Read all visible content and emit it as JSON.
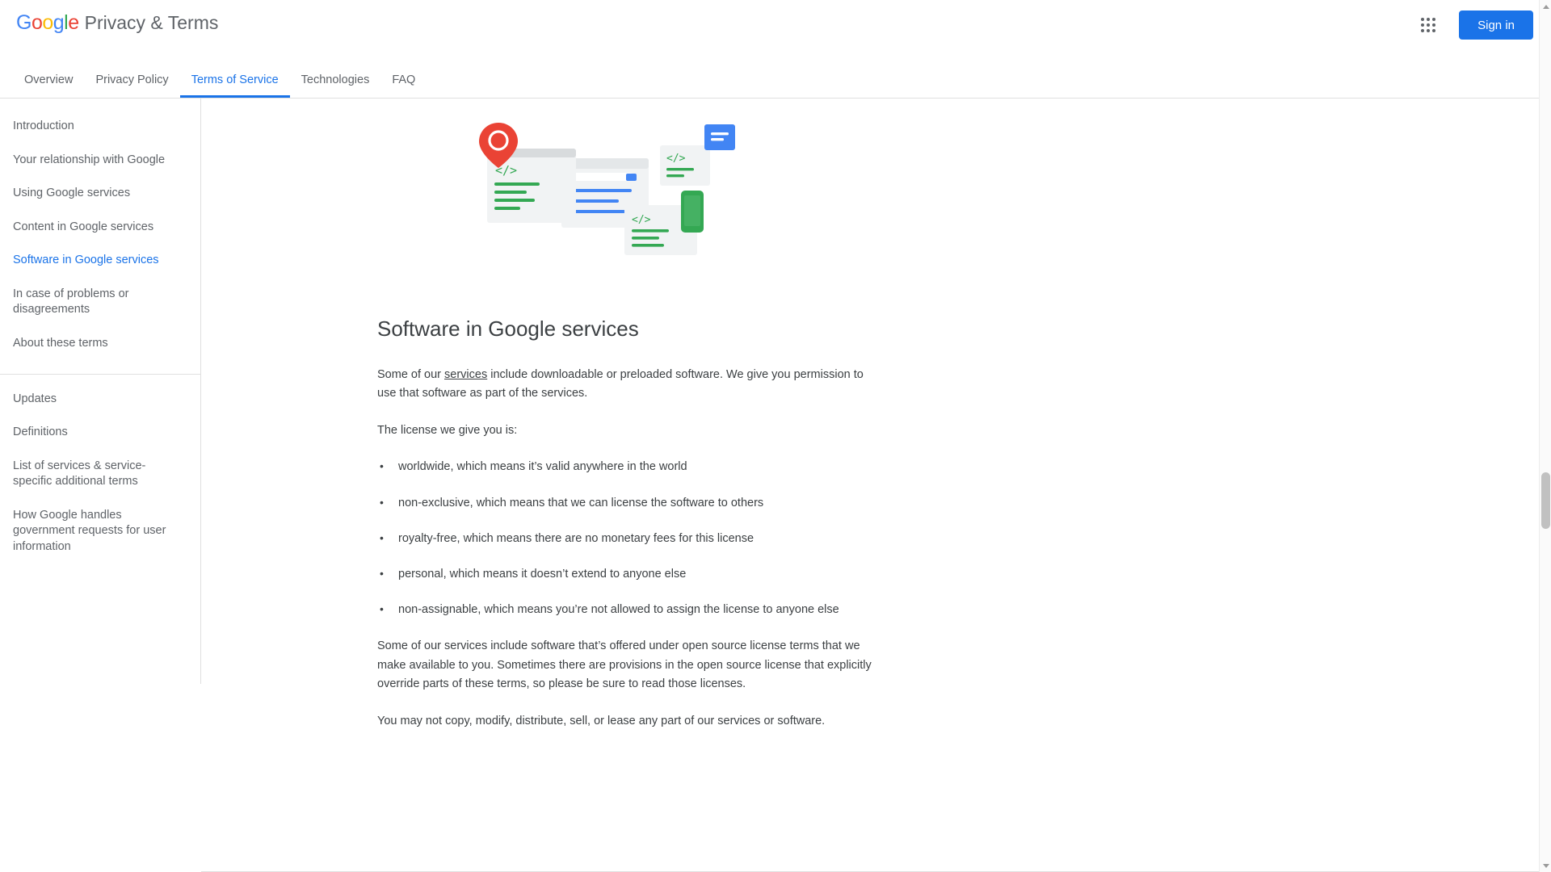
{
  "header": {
    "logo_text": "Google",
    "title": "Privacy & Terms",
    "apps_icon": "apps-grid-icon",
    "signin_label": "Sign in"
  },
  "tabs": [
    {
      "label": "Overview",
      "active": false
    },
    {
      "label": "Privacy Policy",
      "active": false
    },
    {
      "label": "Terms of Service",
      "active": true
    },
    {
      "label": "Technologies",
      "active": false
    },
    {
      "label": "FAQ",
      "active": false
    }
  ],
  "sidebar": {
    "primary": [
      {
        "label": "Introduction",
        "active": false
      },
      {
        "label": "Your relationship with Google",
        "active": false
      },
      {
        "label": "Using Google services",
        "active": false
      },
      {
        "label": "Content in Google services",
        "active": false
      },
      {
        "label": "Software in Google services",
        "active": true
      },
      {
        "label": "In case of problems or disagreements",
        "active": false
      },
      {
        "label": "About these terms",
        "active": false
      }
    ],
    "secondary": [
      {
        "label": "Updates"
      },
      {
        "label": "Definitions"
      },
      {
        "label": "List of services & service-specific additional terms"
      },
      {
        "label": "How Google handles government requests for user information"
      }
    ]
  },
  "main": {
    "illustration_name": "software-services-illustration",
    "page_title": "Software in Google services",
    "intro_before_link": "Some of our ",
    "intro_link": "services",
    "intro_after_link": " include downloadable or preloaded software. We give you permission to use that software as part of the services.",
    "license_lead": "The license we give you is:",
    "license_items": [
      "worldwide, which means it’s valid anywhere in the world",
      "non-exclusive, which means that we can license the software to others",
      "royalty-free, which means there are no monetary fees for this license",
      "personal, which means it doesn’t extend to anyone else",
      "non-assignable, which means you’re not allowed to assign the license to anyone else"
    ],
    "open_source_para": "Some of our services include software that’s offered under open source license terms that we make available to you. Sometimes there are provisions in the open source license that explicitly override parts of these terms, so please be sure to read those licenses.",
    "closing_para": "You may not copy, modify, distribute, sell, or lease any part of our services or software."
  },
  "colors": {
    "accent_blue": "#1a73e8",
    "text_gray": "#3c4043",
    "muted_gray": "#5f6368",
    "google_blue": "#4285F4",
    "google_red": "#EA4335",
    "google_yellow": "#FBBC05",
    "google_green": "#34A853",
    "illustration_green": "#34A853",
    "illustration_red": "#EA4335"
  },
  "scrollbar": {
    "up_arrow": "scroll-up-arrow-icon",
    "down_arrow": "scroll-down-arrow-icon"
  }
}
